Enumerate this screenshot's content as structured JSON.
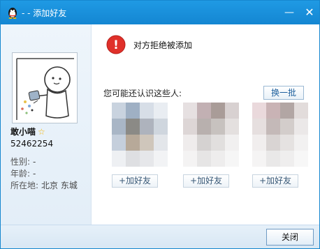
{
  "window": {
    "title": "- - 添加好友",
    "minimize_glyph": "—",
    "close_glyph": "✕",
    "accent_color": "#1486d2",
    "icons": {
      "app": "qq-penguin-icon",
      "minimize": "minimize-icon",
      "close": "close-icon"
    }
  },
  "profile": {
    "nickname": "敢小喵",
    "star_glyph": "☆",
    "qq_number": "52462254",
    "gender_label": "性别:",
    "gender_value": "-",
    "age_label": "年龄:",
    "age_value": "-",
    "location_label": "所在地:",
    "location_value": "北京  东城"
  },
  "notice": {
    "icon": "error-icon",
    "icon_glyph": "!",
    "icon_color": "#e0302a",
    "message": "对方拒绝被添加"
  },
  "suggestions": {
    "title": "您可能还认识这些人:",
    "refresh_label": "换一批",
    "people": [
      {
        "add_label": "+加好友",
        "palette": [
          "#c9d3df",
          "#9fb0c4",
          "#d7dee7",
          "#e9edf2",
          "#a9b6c6",
          "#8b8a86",
          "#aeb3bd",
          "#cfd6de",
          "#c5cfdc",
          "#b7a999",
          "#cfc6bb",
          "#e3e6ea",
          "#eef0f3",
          "#dedfe2",
          "#e6e7ea",
          "#f2f3f5"
        ]
      },
      {
        "add_label": "+加好友",
        "palette": [
          "#e6e0e1",
          "#c2b0b3",
          "#a99c98",
          "#d8d1d1",
          "#ddd6d6",
          "#b8b0ae",
          "#c7c2bf",
          "#e4e0df",
          "#efecec",
          "#d5d2d1",
          "#e1dfde",
          "#f1f0f0",
          "#f4f3f3",
          "#e6e5e5",
          "#eeeded",
          "#f6f6f6"
        ]
      },
      {
        "add_label": "+加好友",
        "palette": [
          "#ead9dc",
          "#c9b3b5",
          "#b2a6a4",
          "#e2dcdb",
          "#e6dfdf",
          "#c4b9b8",
          "#d3cdcb",
          "#ebe8e8",
          "#f1eeee",
          "#d9d4d3",
          "#e5e2e1",
          "#f2f1f1",
          "#f5f4f4",
          "#e9e8e8",
          "#efeeee",
          "#f7f7f7"
        ]
      }
    ]
  },
  "footer": {
    "close_label": "关闭"
  }
}
